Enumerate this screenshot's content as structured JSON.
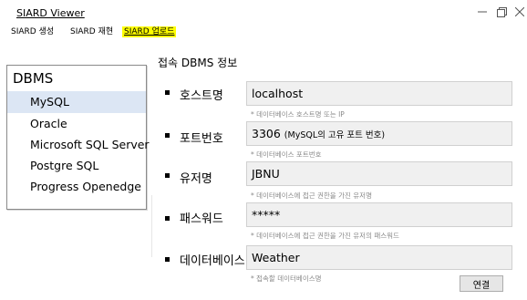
{
  "window": {
    "title": "SIARD Viewer"
  },
  "menu": [
    {
      "label": "SIARD 생성"
    },
    {
      "label": "SIARD 재현"
    },
    {
      "label": "SIARD 업로드"
    }
  ],
  "dbms_list": {
    "header": "DBMS",
    "items": [
      {
        "label": "MySQL"
      },
      {
        "label": "Oracle"
      },
      {
        "label": "Microsoft SQL Server"
      },
      {
        "label": "Postgre SQL"
      },
      {
        "label": "Progress Openedge"
      }
    ],
    "selected": "MySQL"
  },
  "form": {
    "section_title": "접속 DBMS 정보",
    "fields": [
      {
        "label": "호스트명",
        "value": "localhost",
        "value_note": "",
        "hint": "* 데이터베이스 호스트명 또는 IP"
      },
      {
        "label": "포트번호",
        "value": "3306",
        "value_note": "(MySQL의 고유 포트 번호)",
        "hint": "* 데이터베이스 포트번호"
      },
      {
        "label": "유저명",
        "value": "JBNU",
        "value_note": "",
        "hint": "* 데이터베이스에 접근 권한을 가진 유저명"
      },
      {
        "label": "패스워드",
        "value": "*****",
        "value_note": "",
        "hint": "* 데이터베이스에 접근 권한을 가진 유저의 패스워드"
      },
      {
        "label": "데이터베이스",
        "value": "Weather",
        "value_note": "",
        "hint": "* 접속할 데이터베이스명"
      }
    ],
    "connect_label": "연결"
  }
}
